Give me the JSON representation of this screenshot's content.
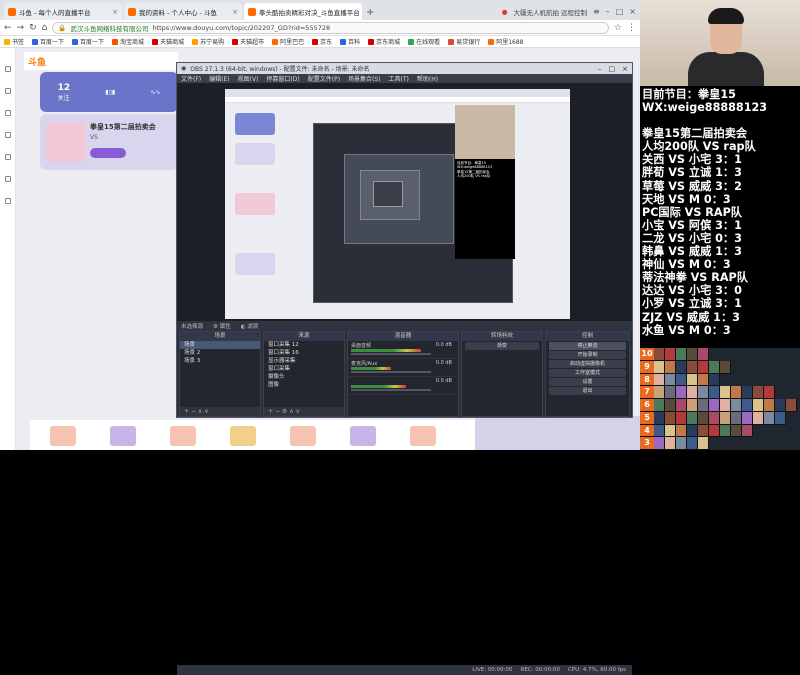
{
  "browser": {
    "tabs": [
      {
        "label": "斗鱼 - 每个人的直播平台",
        "color": "#ff6a00",
        "active": false
      },
      {
        "label": "我的资料 - 个人中心 - 斗鱼",
        "color": "#ff6a00",
        "active": false
      },
      {
        "label": "拳头酷拍卖精彩对决_斗鱼直播平台",
        "color": "#ff6a00",
        "active": true
      }
    ],
    "new_tab": "+",
    "tab_extra": "大疆无人机航拍 远程控制",
    "address": {
      "site": "武汉斗鱼网络科技有限公司",
      "url": "https://www.douyu.com/topic/202207_GD?rid=555728"
    },
    "bookmarks": [
      "书签",
      "百度一下",
      "百度一下",
      "淘宝商城",
      "天猫商城",
      "苏宁易购",
      "天猫超市",
      "阿里巴巴",
      "京东",
      "百科",
      "京东商城",
      "在线观看",
      "易贷银行",
      "阿里1688"
    ]
  },
  "page": {
    "logo": "斗鱼",
    "stats": [
      {
        "value": "12",
        "label": "关注"
      },
      {
        "value": "",
        "label": ""
      },
      {
        "value": "",
        "label": ""
      }
    ],
    "banner_title": "拳皇15第二届拍卖会",
    "banner_sub": "VS"
  },
  "obs": {
    "title": "OBS 27.1.3 (64-bit, windows) - 配置文件: 未命名 - 场景: 未命名",
    "menu": [
      "文件(F)",
      "编辑(E)",
      "视图(V)",
      "停靠窗口(D)",
      "配置文件(P)",
      "场景集合(S)",
      "工具(T)",
      "帮助(H)"
    ],
    "source_head": [
      "未选择源",
      "属性",
      "滤镜"
    ],
    "scenes_title": "场景",
    "scenes": [
      "场景",
      "场景 2",
      "场景 3"
    ],
    "sources_title": "来源",
    "sources": [
      "窗口采集 12",
      "窗口采集 16",
      "显示器采集",
      "窗口采集",
      "摄像头",
      "图像"
    ],
    "mixer_title": "混音器",
    "mixer": [
      {
        "label": "桌面音频",
        "db": "0.0 dB"
      },
      {
        "label": "麦克风/Aux",
        "db": "0.0 dB"
      },
      {
        "label": "",
        "db": "0.0 dB"
      }
    ],
    "transitions_title": "转场特效",
    "transition_value": "渐变",
    "controls_title": "控制",
    "controls": [
      "停止推流",
      "开始录制",
      "启动虚拟摄像机",
      "工作室模式",
      "设置",
      "退出"
    ],
    "status": [
      "LIVE: 00:00:00",
      "REC: 00:00:00",
      "CPU: 4.7%, 60.00 fps"
    ]
  },
  "overlay": {
    "lines": [
      "目前节目：拳皇15",
      "WX:weige88888123",
      "",
      "拳皇15第二届拍卖会",
      "人均200队 VS rap队",
      "关西 VS 小宅 3：1",
      "胖荀 VS 立诚 1：3",
      "草莓 VS 威威 3：2",
      "天地 VS  M  0：3",
      "PC国际 VS RAP队",
      "小宝 VS 阿傧 3：1",
      "二龙 VS 小宅 0：3",
      "韩鼻 VS 威威 1：3",
      "神仙 VS  M  0：3",
      "蒂法神拳 VS RAP队",
      "达达 VS 小宅 3：0",
      "小罗 VS 立诚 3：1",
      "ZJZ VS 威威 1：3",
      "水鱼 VS  M  0：3"
    ]
  },
  "tier": {
    "ranks": [
      "10",
      "9",
      "8",
      "7",
      "6",
      "5",
      "4",
      "3"
    ]
  }
}
